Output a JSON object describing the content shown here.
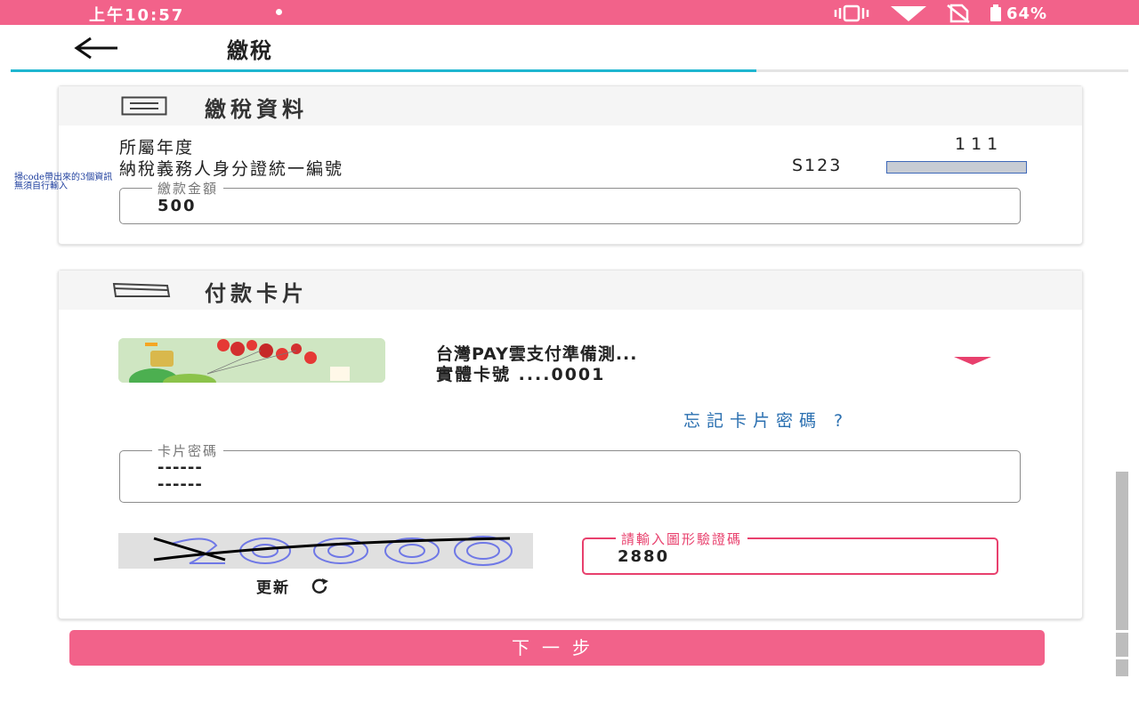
{
  "status_bar": {
    "time": "上午10:57",
    "battery": "64%",
    "icons": [
      "vibrate-icon",
      "wifi-icon",
      "no-sim-icon",
      "battery-icon"
    ]
  },
  "header": {
    "title": "繳稅"
  },
  "tax_info": {
    "section_title": "繳稅資料",
    "year_label": "所屬年度",
    "year_value": "111",
    "id_label": "納稅義務人身分證統一編號",
    "id_value": "S123",
    "annotation_line1": "掃code帶出來的3個資訊",
    "annotation_line2": "無須自行輸入",
    "amount_label": "繳款金額",
    "amount_value": "500"
  },
  "payment_card": {
    "section_title": "付款卡片",
    "card_name": "台灣PAY雲支付準備測...",
    "card_number": "實體卡號 ....0001",
    "forgot_password": "忘記卡片密碼 ?",
    "password_label": "卡片密碼",
    "password_line1": "------",
    "password_line2": "------",
    "refresh_label": "更新",
    "captcha_label": "請輸入圖形驗證碼",
    "captcha_value": "2880"
  },
  "next_button": "下一步",
  "colors": {
    "brand_pink": "#f2628a",
    "accent_red": "#e8406d",
    "tab_blue": "#1fb6d0",
    "link_blue": "#2a6fb0"
  }
}
